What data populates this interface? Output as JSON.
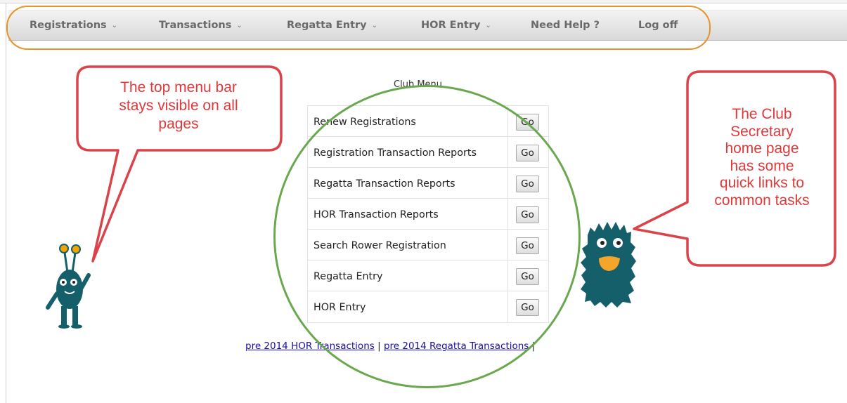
{
  "menu": {
    "items": [
      {
        "label": "Registrations",
        "dropdown": true
      },
      {
        "label": "Transactions",
        "dropdown": true
      },
      {
        "label": "Regatta Entry",
        "dropdown": true
      },
      {
        "label": "HOR Entry",
        "dropdown": true
      },
      {
        "label": "Need Help ?",
        "dropdown": false
      },
      {
        "label": "Log off",
        "dropdown": false
      }
    ]
  },
  "club_menu": {
    "title": "Club Menu",
    "rows": [
      {
        "label": "Renew Registrations",
        "button": "Go"
      },
      {
        "label": "Registration Transaction Reports",
        "button": "Go"
      },
      {
        "label": "Regatta Transaction Reports",
        "button": "Go"
      },
      {
        "label": "HOR Transaction Reports",
        "button": "Go"
      },
      {
        "label": "Search Rower Registration",
        "button": "Go"
      },
      {
        "label": "Regatta Entry",
        "button": "Go"
      },
      {
        "label": "HOR Entry",
        "button": "Go"
      }
    ]
  },
  "footer_links": {
    "link1": "pre 2014 HOR Transactions",
    "separator": "|",
    "link2": "pre 2014 Regatta Transactions"
  },
  "callouts": {
    "left": [
      "The top menu bar",
      "stays visible on all",
      "pages"
    ],
    "right": [
      "The Club",
      "Secretary",
      "home page",
      "has some",
      "quick links to",
      "common tasks"
    ]
  },
  "colors": {
    "menu_oval": "#e9922b",
    "table_oval": "#6aa84f",
    "callout_border": "#d9434a",
    "callout_text": "#e0393a",
    "monster": "#155f6b"
  }
}
